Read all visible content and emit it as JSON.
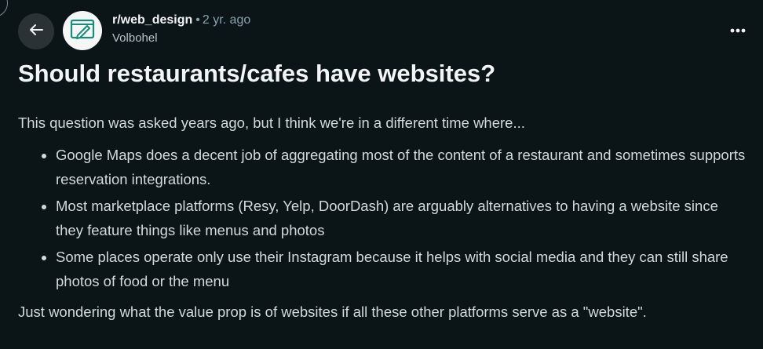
{
  "post": {
    "subreddit": "r/web_design",
    "separator": "•",
    "age": "2 yr. ago",
    "author": "Volbohel",
    "title": "Should restaurants/cafes have websites?",
    "intro": "This question was asked years ago, but I think we're in a different time where...",
    "bullets": [
      "Google Maps does a decent job of aggregating most of the content of a restaurant and sometimes supports reservation integrations.",
      "Most marketplace platforms (Resy, Yelp, DoorDash) are arguably alternatives to having a website since they feature things like menus and photos",
      "Some places operate only use their Instagram because it helps with social media and they can still share photos of food or the menu"
    ],
    "closing": "Just wondering what the value prop is of websites if all these other platforms serve as a \"website\"."
  },
  "icons": {
    "back": "arrow-left-icon",
    "avatar": "subreddit-avatar-icon",
    "more": "more-horizontal-icon"
  },
  "colors": {
    "background": "#0b1416",
    "button_bg": "#2a3236",
    "text_primary": "#f2f4f5",
    "text_body": "#d3dadd",
    "text_muted": "#8ba2ad",
    "avatar_accent": "#1b8a7a"
  }
}
